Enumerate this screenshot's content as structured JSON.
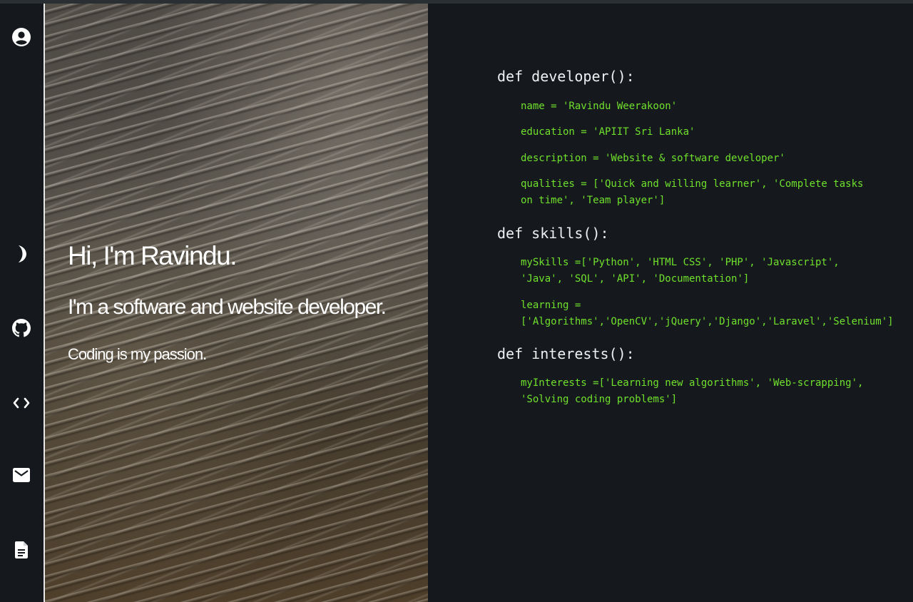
{
  "sidebar": {
    "items": [
      {
        "name": "profile",
        "icon": "user-circle-icon"
      },
      {
        "name": "theme",
        "icon": "moon-icon"
      },
      {
        "name": "github",
        "icon": "github-icon"
      },
      {
        "name": "projects",
        "icon": "code-icon"
      },
      {
        "name": "contact",
        "icon": "mail-icon"
      },
      {
        "name": "resume",
        "icon": "document-icon"
      }
    ]
  },
  "hero": {
    "greeting": "Hi, I'm Ravindu.",
    "role": "I'm a software and website developer.",
    "passion": "Coding is my passion."
  },
  "code": {
    "developer": {
      "def": "def developer():",
      "name": "name = 'Ravindu Weerakoon'",
      "education": "education = 'APIIT Sri Lanka'",
      "description": "description = 'Website & software developer'",
      "qualities": "qualities = ['Quick and willing learner', 'Complete tasks on time', 'Team player']"
    },
    "skills": {
      "def": "def skills():",
      "mySkills": "mySkills =['Python', 'HTML CSS', 'PHP', 'Javascript', 'Java', 'SQL', 'API', 'Documentation']",
      "learning": "learning = ['Algorithms','OpenCV','jQuery','Django','Laravel','Selenium']"
    },
    "interests": {
      "def": "def interests():",
      "myInterests": "myInterests =['Learning new algorithms', 'Web-scrapping', 'Solving coding problems']"
    }
  },
  "colors": {
    "background": "#15191d",
    "code_text": "#6fe02c",
    "def_text": "#eef0f2"
  }
}
